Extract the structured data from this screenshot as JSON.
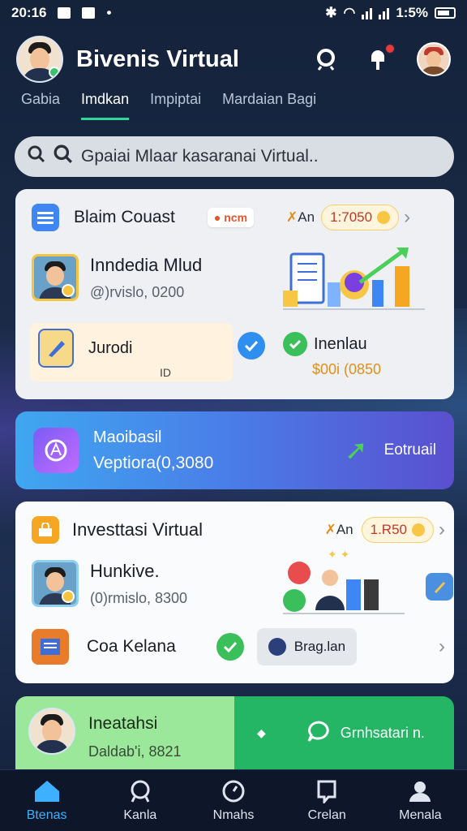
{
  "status": {
    "time": "20:16",
    "battery": "1:5%"
  },
  "header": {
    "title": "Bivenis Virtual"
  },
  "tabs": [
    {
      "label": "Gabia"
    },
    {
      "label": "Imdkan"
    },
    {
      "label": "Impiptai"
    },
    {
      "label": "Mardaian Bagi"
    }
  ],
  "search": {
    "placeholder": "Gpaiai Mlaar kasaranai Virtual.."
  },
  "card1": {
    "title": "Blaim Couast",
    "tag": "ncm",
    "an": "An",
    "points": "1:7050",
    "person_name": "Inndedia Mlud",
    "person_value": "@)rvislo, 0200",
    "item_label": "Jurodi",
    "item_sub": "ID",
    "stat_title": "Inenlau",
    "stat_value": "$00i (0850"
  },
  "promo": {
    "title": "Maoibasil",
    "value": "Veptiora(0,3080",
    "action": "Eotruail"
  },
  "card3": {
    "title": "Investtasi Virtual",
    "an": "An",
    "points": "1.R50",
    "person_name": "Hunkive.",
    "person_value": "(0)rmislo, 8300",
    "item_label": "Coa Kelana",
    "button": "Brag.lan"
  },
  "card4": {
    "name": "Ineatahsi",
    "value": "Daldab'i, 8821",
    "action": "Grnhsatari n."
  },
  "nav": [
    {
      "label": "Btenas"
    },
    {
      "label": "Kanla"
    },
    {
      "label": "Nmahs"
    },
    {
      "label": "Crelan"
    },
    {
      "label": "Menala"
    }
  ],
  "colors": {
    "accent": "#2ed69a",
    "nav_active": "#3db1ff",
    "promo_start": "#3fa7f0",
    "promo_end": "#5a4fcf",
    "green": "#24b565"
  }
}
